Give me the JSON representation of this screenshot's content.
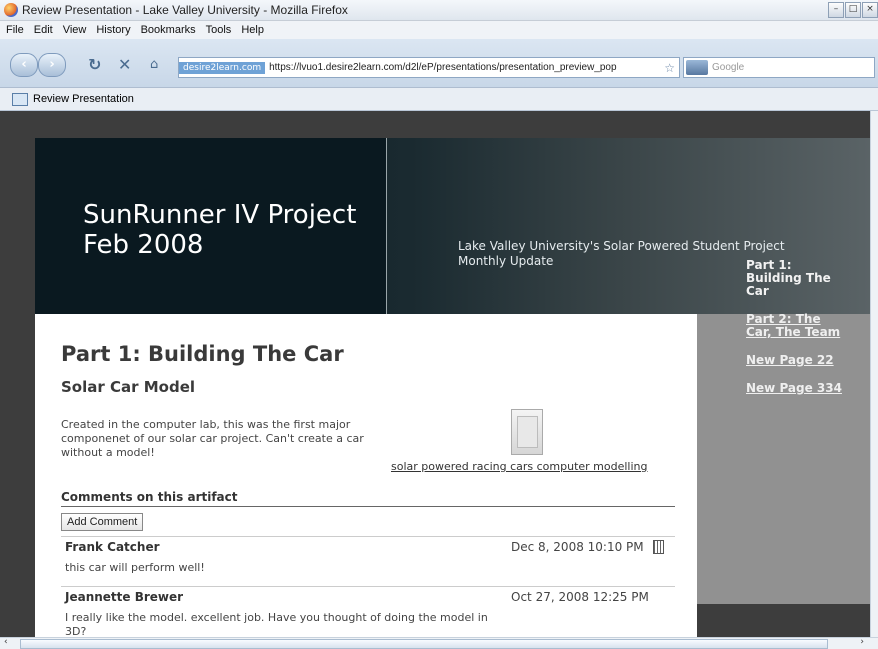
{
  "window": {
    "title": "Review Presentation - Lake Valley University - Mozilla Firefox"
  },
  "menu": [
    "File",
    "Edit",
    "View",
    "History",
    "Bookmarks",
    "Tools",
    "Help"
  ],
  "nav": {
    "site_badge": "desire2learn.com",
    "url": "https://lvuo1.desire2learn.com/d2l/eP/presentations/presentation_preview_pop",
    "search_placeholder": "Google"
  },
  "tab": {
    "label": "Review Presentation"
  },
  "hero": {
    "title_line1": "SunRunner IV Project",
    "title_line2": "Feb 2008",
    "subtitle_line1": "Lake Valley University's Solar Powered Student Project",
    "subtitle_line2": "Monthly Update"
  },
  "content": {
    "page_heading": "Part 1: Building The Car",
    "section_heading": "Solar Car Model",
    "description": "Created in the computer lab, this was the first major componenet of our solar car project. Can't create a car without a model!",
    "artifact_link": "solar powered racing cars computer modelling",
    "comments_heading": "Comments on this artifact",
    "add_comment_label": "Add Comment",
    "comments": [
      {
        "author": "Frank Catcher",
        "date": "Dec 8, 2008 10:10 PM",
        "text": "this car will perform well!"
      },
      {
        "author": "Jeannette Brewer",
        "date": "Oct 27, 2008 12:25 PM",
        "text": "I really like the model. excellent job. Have you thought of doing the model in 3D?"
      }
    ]
  },
  "sidebar": {
    "current": "Part 1: Building The Car",
    "links": [
      "Part 2: The Car, The Team",
      "New Page 22",
      "New Page 334"
    ]
  },
  "colors": {
    "hero_dark": "#0a1920",
    "side_panel": "#919191",
    "page_bg": "#3d3d3d"
  },
  "icons": [
    "firefox-icon",
    "back-icon",
    "forward-icon",
    "reload-icon",
    "stop-icon",
    "home-icon",
    "star-icon",
    "search-engine-icon",
    "page-icon",
    "trash-icon"
  ]
}
